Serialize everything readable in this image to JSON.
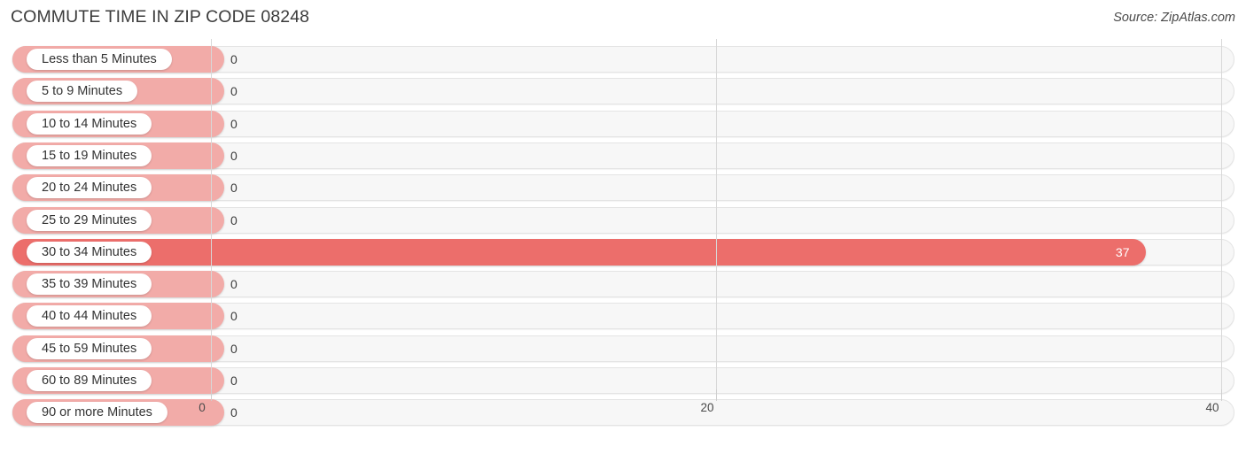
{
  "header": {
    "title": "COMMUTE TIME IN ZIP CODE 08248",
    "source": "Source: ZipAtlas.com"
  },
  "colors": {
    "bar": "#f2aba8",
    "bar_highlight": "#ec6e6b",
    "track": "#f7f7f7",
    "gridline": "#d8d8d8",
    "text": "#3c3c3c",
    "value_on_bar": "#ffffff"
  },
  "chart_data": {
    "type": "bar",
    "orientation": "horizontal",
    "title": "COMMUTE TIME IN ZIP CODE 08248",
    "subtitle": "Source: ZipAtlas.com",
    "xlabel": "",
    "ylabel": "",
    "xlim": [
      0,
      40
    ],
    "grid": true,
    "legend": null,
    "xticks": [
      0,
      20,
      40
    ],
    "xtick_labels": [
      "0",
      "20",
      "40"
    ],
    "categories": [
      "Less than 5 Minutes",
      "5 to 9 Minutes",
      "10 to 14 Minutes",
      "15 to 19 Minutes",
      "20 to 24 Minutes",
      "25 to 29 Minutes",
      "30 to 34 Minutes",
      "35 to 39 Minutes",
      "40 to 44 Minutes",
      "45 to 59 Minutes",
      "60 to 89 Minutes",
      "90 or more Minutes"
    ],
    "values": [
      0,
      0,
      0,
      0,
      0,
      0,
      37,
      0,
      0,
      0,
      0,
      0
    ],
    "value_labels": [
      "0",
      "0",
      "0",
      "0",
      "0",
      "0",
      "37",
      "0",
      "0",
      "0",
      "0",
      "0"
    ],
    "highlight_index": 6
  }
}
